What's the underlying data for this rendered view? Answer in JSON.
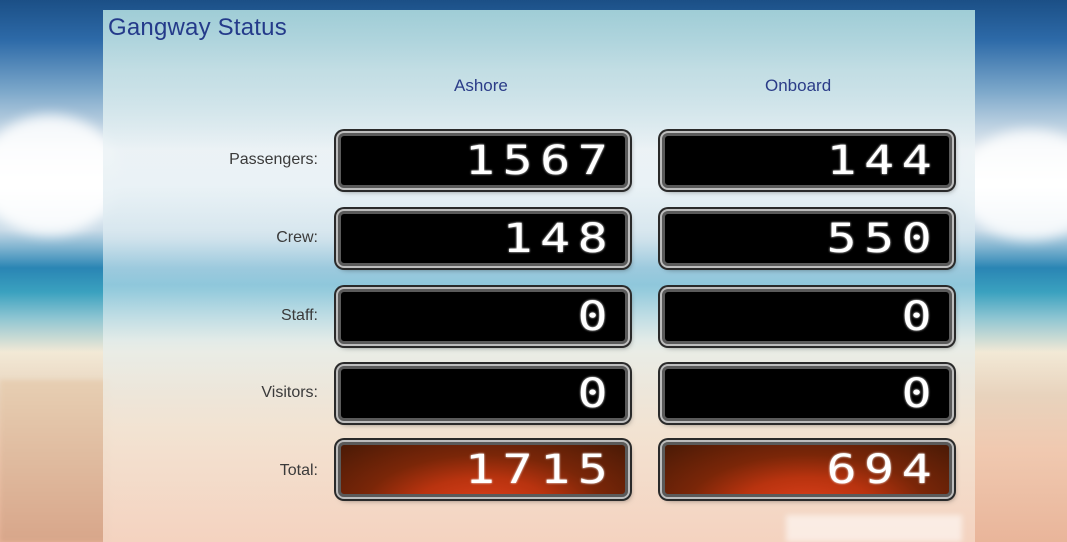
{
  "title": "Gangway Status",
  "columns": {
    "ashore": "Ashore",
    "onboard": "Onboard"
  },
  "rows": [
    {
      "label": "Passengers:",
      "ashore": "1567",
      "onboard": "144"
    },
    {
      "label": "Crew:",
      "ashore": "148",
      "onboard": "550"
    },
    {
      "label": "Staff:",
      "ashore": "0",
      "onboard": "0"
    },
    {
      "label": "Visitors:",
      "ashore": "0",
      "onboard": "0"
    },
    {
      "label": "Total:",
      "ashore": "1715",
      "onboard": "694"
    }
  ],
  "colors": {
    "title": "#243a8a",
    "display_bg": "#000000",
    "total_bg": "#b8330f",
    "digits": "#ffffff"
  }
}
